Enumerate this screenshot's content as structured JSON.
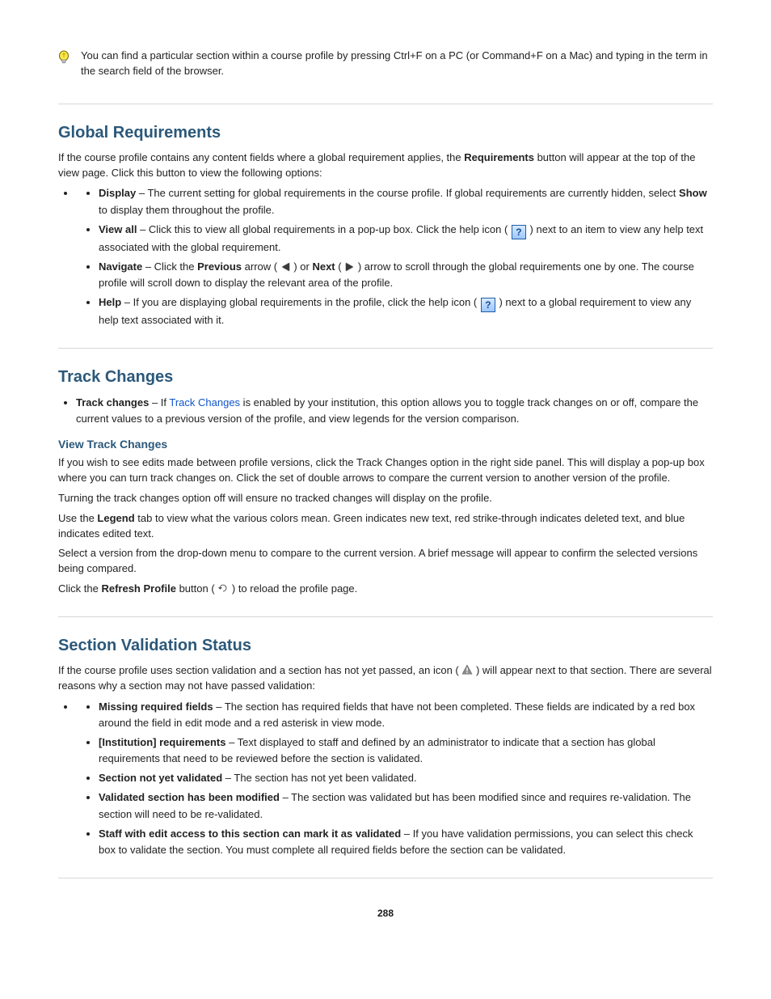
{
  "tip": {
    "text": "You can find a particular section within a course profile by pressing Ctrl+F on a PC (or Command+F on a Mac) and typing in the term in the search field of the browser."
  },
  "globalRequirements": {
    "heading": "Global Requirements",
    "intro_html": "If the course profile contains any content fields where a global requirement applies, the <b>Requirements</b> button will appear at the top of the view page. Click this button to view the following options:",
    "items": [
      {
        "html": "<b>Display</b> – The current setting for global requirements in the course profile. If global requirements are currently hidden, select <b>Show</b> to display them throughout the profile."
      },
      {
        "html": "<b>View all</b> – Click this to view all global requirements in a pop-up box. Click the help icon ( <span class=\"icon-help\" data-name=\"help-icon\" data-interactable=\"false\">?</span> ) next to an item to view any help text associated with the global requirement."
      },
      {
        "html": "<b>Navigate</b> – Click the <b>Previous</b> arrow ( <span class=\"icon-arrow arrow-left\" data-name=\"arrow-left-icon\" data-interactable=\"false\"></span> ) or <b>Next</b> ( <span class=\"icon-arrow arrow-right\" data-name=\"arrow-right-icon\" data-interactable=\"false\"></span> ) arrow to scroll through the global requirements one by one. The course profile will scroll down to display the relevant area of the profile."
      },
      {
        "html": "<b>Help</b> – If you are displaying global requirements in the profile, click the help icon ( <span class=\"icon-help\" data-name=\"help-icon\" data-interactable=\"false\">?</span> ) next to a global requirement to view any help text associated with it."
      }
    ]
  },
  "trackChanges": {
    "heading": "Track Changes",
    "intro_bullet_html": "<b>Track changes</b> – If <a href=\"#\" class=\"link\" data-name=\"track-changes-link\" data-interactable=\"true\">Track Changes</a> is enabled by your institution, this option allows you to toggle track changes on or off, compare the current values to a previous version of the profile, and view legends for the version comparison.",
    "subhead": "View Track Changes",
    "p1": "If you wish to see edits made between profile versions, click the Track Changes option in the right side panel. This will display a pop-up box where you can turn track changes on. Click the set of double arrows to compare the current version to another version of the profile.",
    "p2": "Turning the track changes option off will ensure no tracked changes will display on the profile.",
    "p3": "Use the <b>Legend</b> tab to view what the various colors mean. Green indicates new text, red strike-through indicates deleted text, and blue indicates edited text.",
    "p4": "Select a version from the drop-down menu to compare to the current version. A brief message will appear to confirm the selected versions being compared.",
    "p5_html": "Click the <b>Refresh Profile</b> button ( <span class=\"icon icon-refresh\" data-name=\"refresh-icon\" data-interactable=\"false\"><svg viewBox=\"0 0 16 16\" width=\"14\" height=\"14\"><path fill=\"#444\" d=\"M8 3a5 5 0 0 0-4.9 4H1l3 3 3-3H4.1A4 4 0 1 1 8 12v1a5 5 0 1 0 0-10z\"/></svg></span> ) to reload the profile page."
  },
  "validationStatus": {
    "heading": "Section Validation Status",
    "p1_html": "If the course profile uses section validation and a section has not yet passed, an icon ( <span class=\"icon icon-warn\" data-name=\"warning-icon\" data-interactable=\"false\"><svg viewBox=\"0 0 16 16\" width=\"14\" height=\"14\"><path fill=\"#8a8a8a\" stroke=\"#4a4a4a\" stroke-width=\"0.5\" d=\"M8 1 1 14h14L8 1z\"/><rect x=\"7.2\" y=\"5\" width=\"1.6\" height=\"5\" fill=\"#fff\"/><rect x=\"7.2\" y=\"11\" width=\"1.6\" height=\"1.6\" fill=\"#fff\"/></svg></span> ) will appear next to that section. There are several reasons why a section may not have passed validation:",
    "items": [
      {
        "html": "<b>Missing required fields</b> – The section has required fields that have not been completed. These fields are indicated by a red box around the field in edit mode and a red asterisk in view mode."
      },
      {
        "html": "<b>[Institution] requirements</b> – Text displayed to staff and defined by an administrator to indicate that a section has global requirements that need to be reviewed before the section is validated."
      },
      {
        "html": "<b>Section not yet validated</b> – The section has not yet been validated."
      },
      {
        "html": "<b>Validated section has been modified</b> – The section was validated but has been modified since and requires re-validation. The section will need to be re-validated."
      },
      {
        "html": "<b>Staff with edit access to this section can mark it as validated</b> – If you have validation permissions, you can select this check box to validate the section. You must complete all required fields before the section can be validated."
      }
    ]
  },
  "footer": {
    "page": "288"
  }
}
